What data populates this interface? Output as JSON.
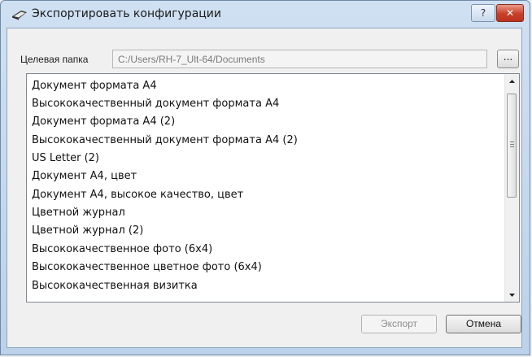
{
  "window": {
    "title": "Экспортировать конфигурации",
    "help_label": "?",
    "close_label": "✕"
  },
  "folder": {
    "label": "Целевая папка",
    "value": "C:/Users/RH-7_Ult-64/Documents",
    "browse_label": "..."
  },
  "list": {
    "items": [
      "Документ формата А4",
      "Высококачественный документ формата А4",
      "Документ формата А4 (2)",
      "Высококачественный документ формата А4 (2)",
      "US Letter (2)",
      "Документ А4, цвет",
      "Документ А4, высокое качество, цвет",
      "Цветной журнал",
      "Цветной журнал (2)",
      "Высококачественное фото (6x4)",
      "Высококачественное цветное фото (6x4)",
      "Высококачественная визитка"
    ]
  },
  "buttons": {
    "export_label": "Экспорт",
    "cancel_label": "Отмена"
  },
  "colors": {
    "titlebar": "#bcd2ea",
    "close_button": "#c9402a",
    "dialog_bg": "#f0f0f0"
  },
  "icons": {
    "title": "scanner-icon",
    "scroll_up": "triangle-up-icon",
    "scroll_down": "triangle-down-icon"
  }
}
